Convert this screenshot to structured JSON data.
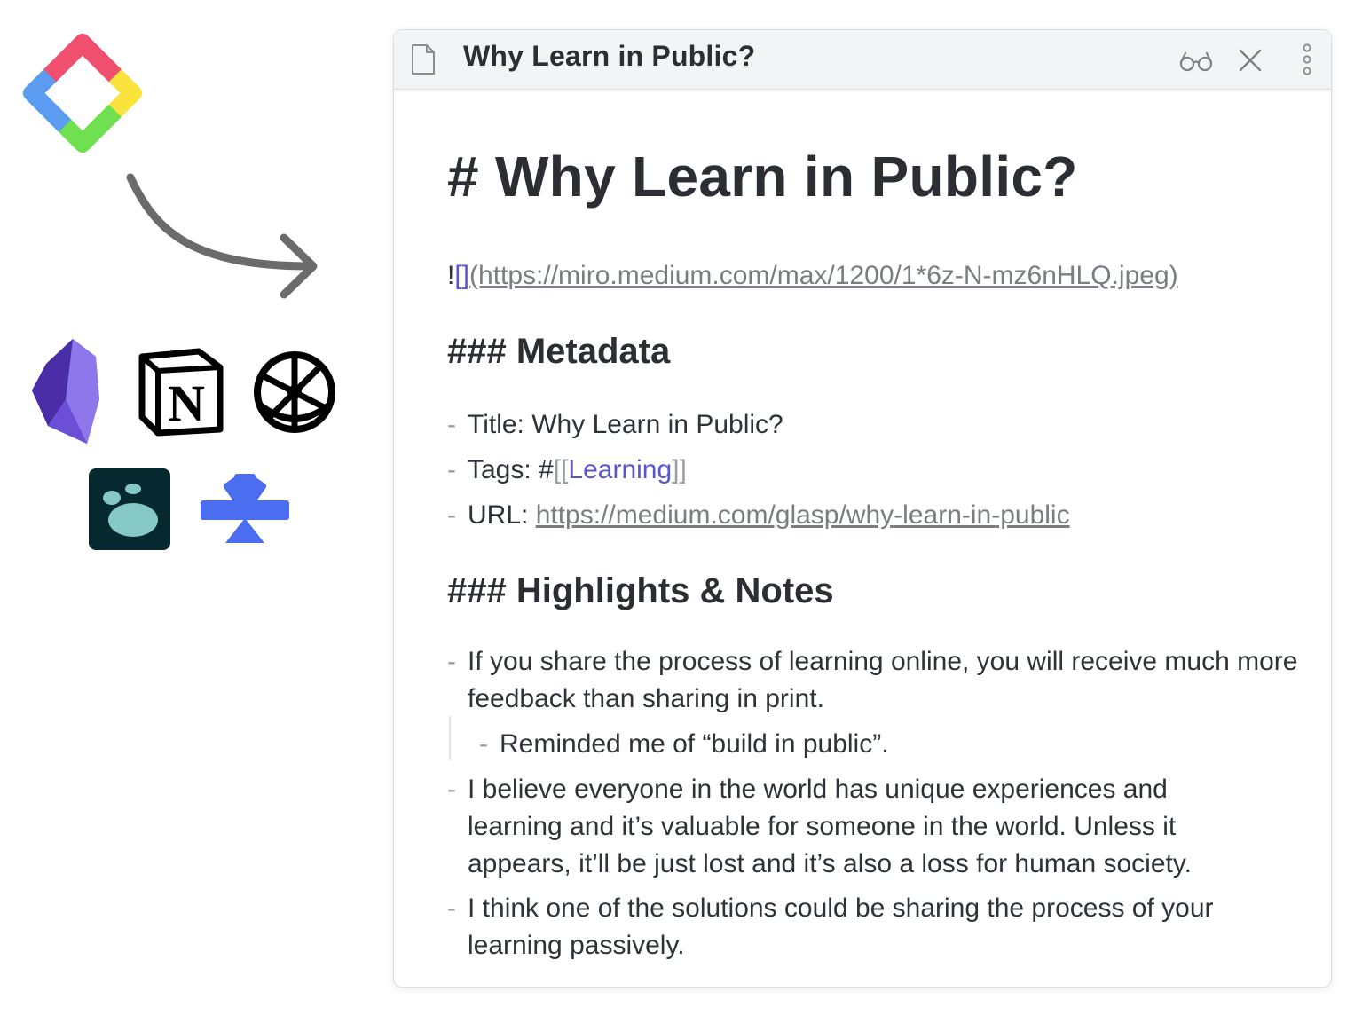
{
  "window": {
    "title": "Why Learn in Public?",
    "icons": {
      "document": "document-icon",
      "reading_mode": "glasses-icon",
      "close": "close-icon",
      "more": "more-options-icon"
    }
  },
  "note": {
    "heading": "# Why Learn in Public?",
    "image_line": {
      "bang": "!",
      "brackets": "[]",
      "url": "(https://miro.medium.com/max/1200/1*6z-N-mz6nHLQ.jpeg)"
    },
    "metadata_heading": "### Metadata",
    "metadata": {
      "title_label": "Title: Why Learn in Public?",
      "tags_prefix": "Tags: #",
      "tags_open": "[[",
      "tags_value": "Learning",
      "tags_close": "]]",
      "url_label": "URL: ",
      "url_value": "https://medium.com/glasp/why-learn-in-public"
    },
    "highlights_heading": "### Highlights & Notes",
    "highlights": [
      "If you share the process of learning online, you will receive much more feedback than sharing in print.",
      "Reminded me of “build in public”.",
      "I believe everyone in the world has unique experiences and learning and it’s valuable for someone in the world. Unless it appears, it’ll be just lost and it’s also a loss for human society.",
      "I think one of the solutions could be sharing the process of your learning passively."
    ],
    "dash": "-"
  },
  "logos": {
    "source": "glasp-logo",
    "arrow": "curved-arrow",
    "targets": [
      "obsidian-logo",
      "notion-logo",
      "roam-research-logo",
      "logseq-logo",
      "capacities-logo"
    ],
    "notion_letter": "N"
  },
  "colors": {
    "link_purple": "#5a56c9",
    "muted_gray": "#7a7d82",
    "titlebar_bg": "#f3f4f5"
  }
}
